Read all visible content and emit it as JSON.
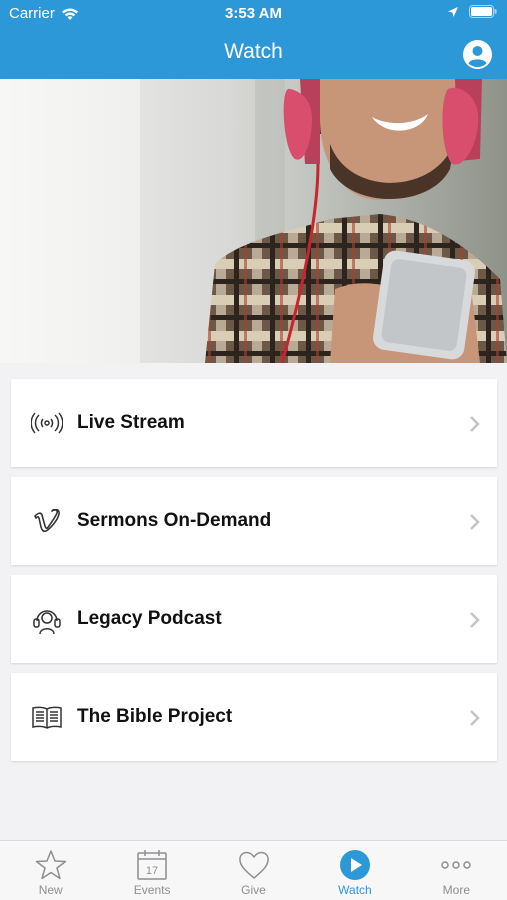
{
  "status_bar": {
    "carrier": "Carrier",
    "time": "3:53 AM"
  },
  "header": {
    "title": "Watch"
  },
  "menu": {
    "items": [
      {
        "label": "Live Stream",
        "icon": "broadcast-icon"
      },
      {
        "label": "Sermons On-Demand",
        "icon": "vimeo-icon"
      },
      {
        "label": "Legacy Podcast",
        "icon": "podcast-icon"
      },
      {
        "label": "The Bible Project",
        "icon": "book-icon"
      }
    ]
  },
  "tabbar": {
    "tabs": [
      {
        "label": "New",
        "icon": "star-icon"
      },
      {
        "label": "Events",
        "icon": "calendar-icon",
        "day": "17"
      },
      {
        "label": "Give",
        "icon": "heart-icon"
      },
      {
        "label": "Watch",
        "icon": "play-icon",
        "active": true
      },
      {
        "label": "More",
        "icon": "more-icon"
      }
    ]
  },
  "colors": {
    "accent": "#2d98d8",
    "inactive": "#8e8e93",
    "background": "#f2f2f4"
  }
}
